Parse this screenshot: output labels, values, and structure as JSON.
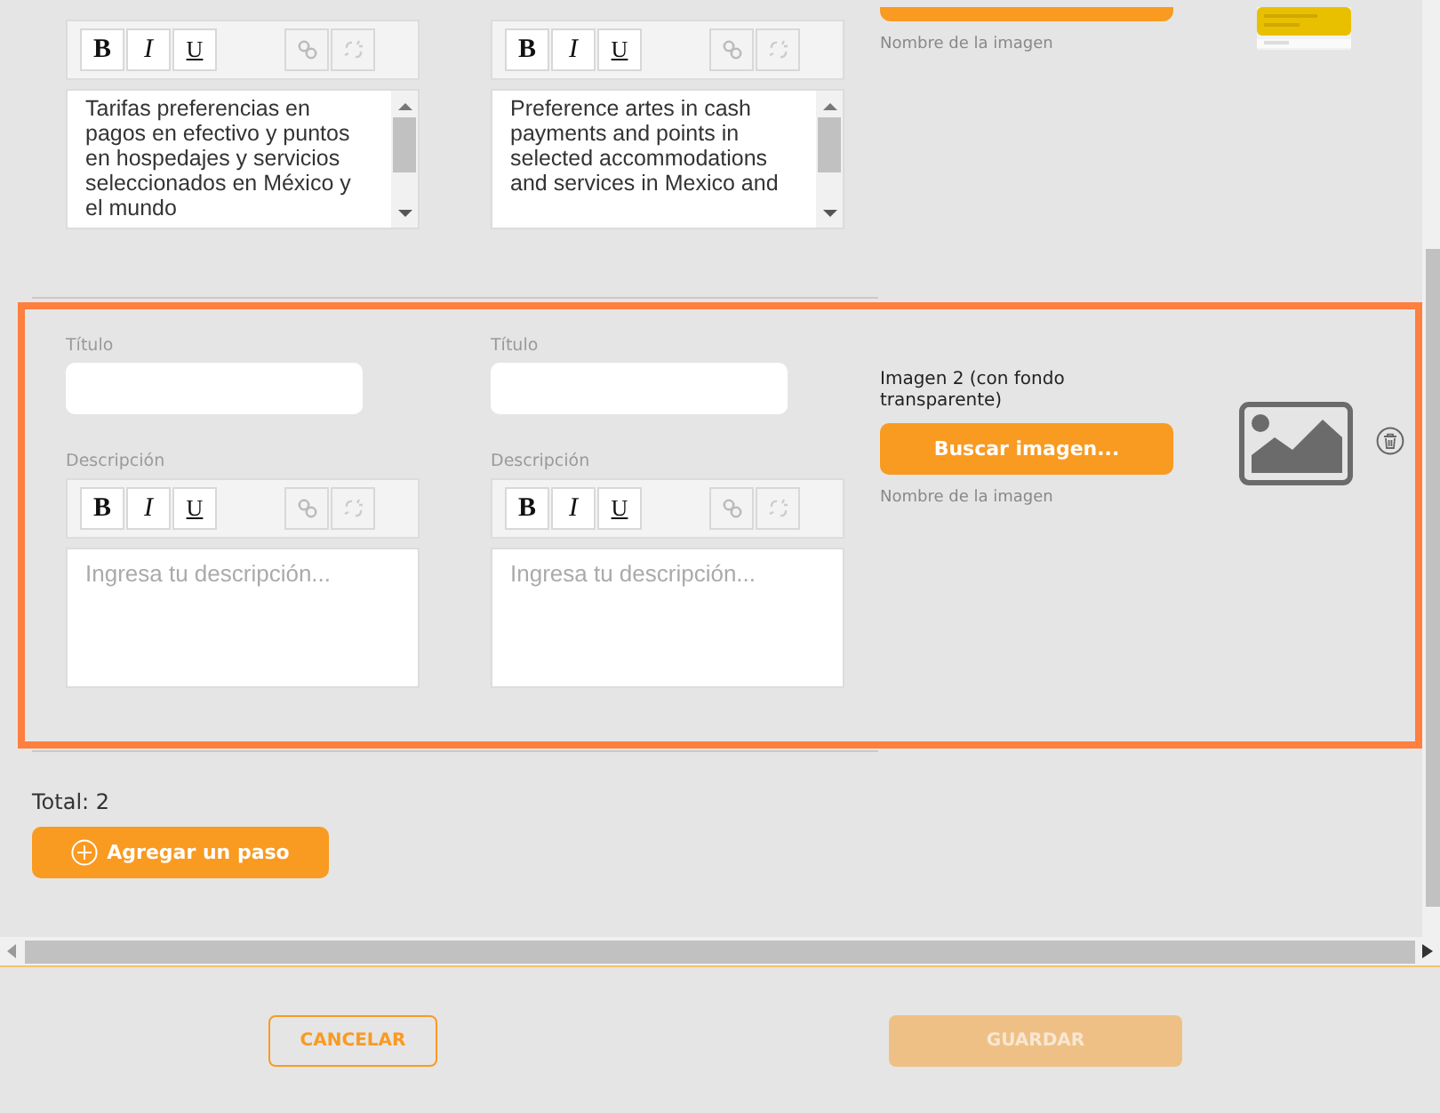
{
  "steps": [
    {
      "highlighted": false,
      "description_es": {
        "toolbar": [
          "B",
          "I",
          "U"
        ],
        "text": "Tarifas preferencias en pagos en efectivo y puntos en hospedajes y servicios seleccionados en México y el mundo"
      },
      "description_en": {
        "toolbar": [
          "B",
          "I",
          "U"
        ],
        "text": "Preference artes in cash payments and points in selected accommodations and services in Mexico and"
      },
      "image": {
        "name_label": "Nombre de la imagen"
      }
    },
    {
      "highlighted": true,
      "title_es": {
        "label": "Título"
      },
      "title_en": {
        "label": "Título"
      },
      "description_es": {
        "label": "Descripción",
        "toolbar": [
          "B",
          "I",
          "U"
        ],
        "placeholder": "Ingresa tu descripción..."
      },
      "description_en": {
        "label": "Descripción",
        "toolbar": [
          "B",
          "I",
          "U"
        ],
        "placeholder": "Ingresa tu descripción..."
      },
      "image": {
        "label": "Imagen 2 (con fondo transparente)",
        "button": "Buscar imagen...",
        "name_label": "Nombre de la imagen",
        "preview": {
          "kind": "placeholder"
        }
      }
    }
  ],
  "total": "Total: 2",
  "add_button": "Agregar un paso",
  "footer": {
    "cancel": "CANCELAR",
    "save": {
      "label": "GUARDAR",
      "disabled": true
    }
  }
}
